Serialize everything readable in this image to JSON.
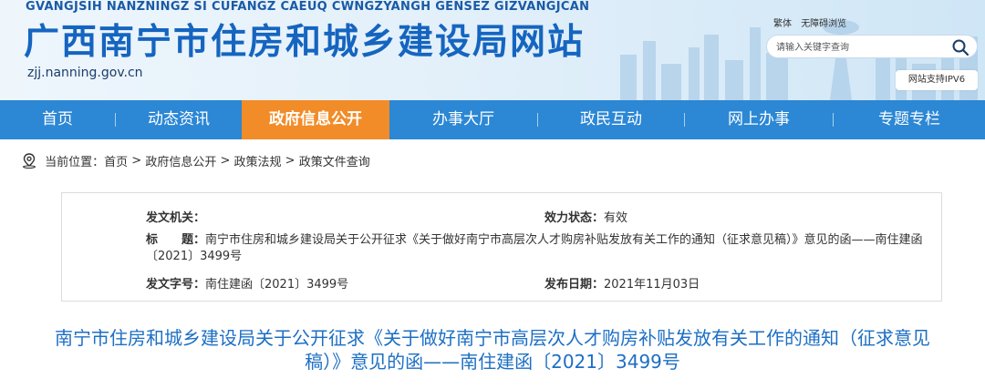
{
  "header": {
    "pinyin": "GVANGJSIH NANZNINGZ SI CUFANGZ CAEUQ CWNGZYANGH GENSEZ GIZVANGJCAN",
    "title": "广西南宁市住房和城乡建设局网站",
    "domain": "zjj.nanning.gov.cn",
    "links": [
      "繁体",
      "无障碍浏览"
    ],
    "search_placeholder": "请输入关键字查询",
    "search_icon": "search-icon",
    "ipv6_badge": "网站支持IPV6"
  },
  "nav": {
    "items": [
      {
        "label": "首页",
        "active": false
      },
      {
        "label": "动态资讯",
        "active": false
      },
      {
        "label": "政府信息公开",
        "active": true
      },
      {
        "label": "办事大厅",
        "active": false
      },
      {
        "label": "政民互动",
        "active": false
      },
      {
        "label": "网上办事",
        "active": false
      },
      {
        "label": "专题专栏",
        "active": false
      }
    ],
    "colors": {
      "bar": "#2c87d4",
      "active": "#f28c28"
    }
  },
  "breadcrumb": {
    "icon": "location-pin-icon",
    "prefix": "当前位置：",
    "items": [
      "首页",
      "政府信息公开",
      "政策法规",
      "政策文件查询"
    ],
    "separator": " > "
  },
  "info": {
    "issuer_label": "发文机关：",
    "issuer_value": "",
    "status_label": "效力状态：",
    "status_value": "有效",
    "title_label": "标　　题：",
    "title_value": "南宁市住房和城乡建设局关于公开征求《关于做好南宁市高层次人才购房补贴发放有关工作的通知（征求意见稿）》意见的函——南住建函〔2021〕3499号",
    "docno_label": "发文字号：",
    "docno_value": "南住建函〔2021〕3499号",
    "date_label": "发布日期：",
    "date_value": "2021年11月03日"
  },
  "article": {
    "title": "南宁市住房和城乡建设局关于公开征求《关于做好南宁市高层次人才购房补贴发放有关工作的通知（征求意见稿）》意见的函——南住建函〔2021〕3499号",
    "title_color": "#1d6fc4"
  }
}
